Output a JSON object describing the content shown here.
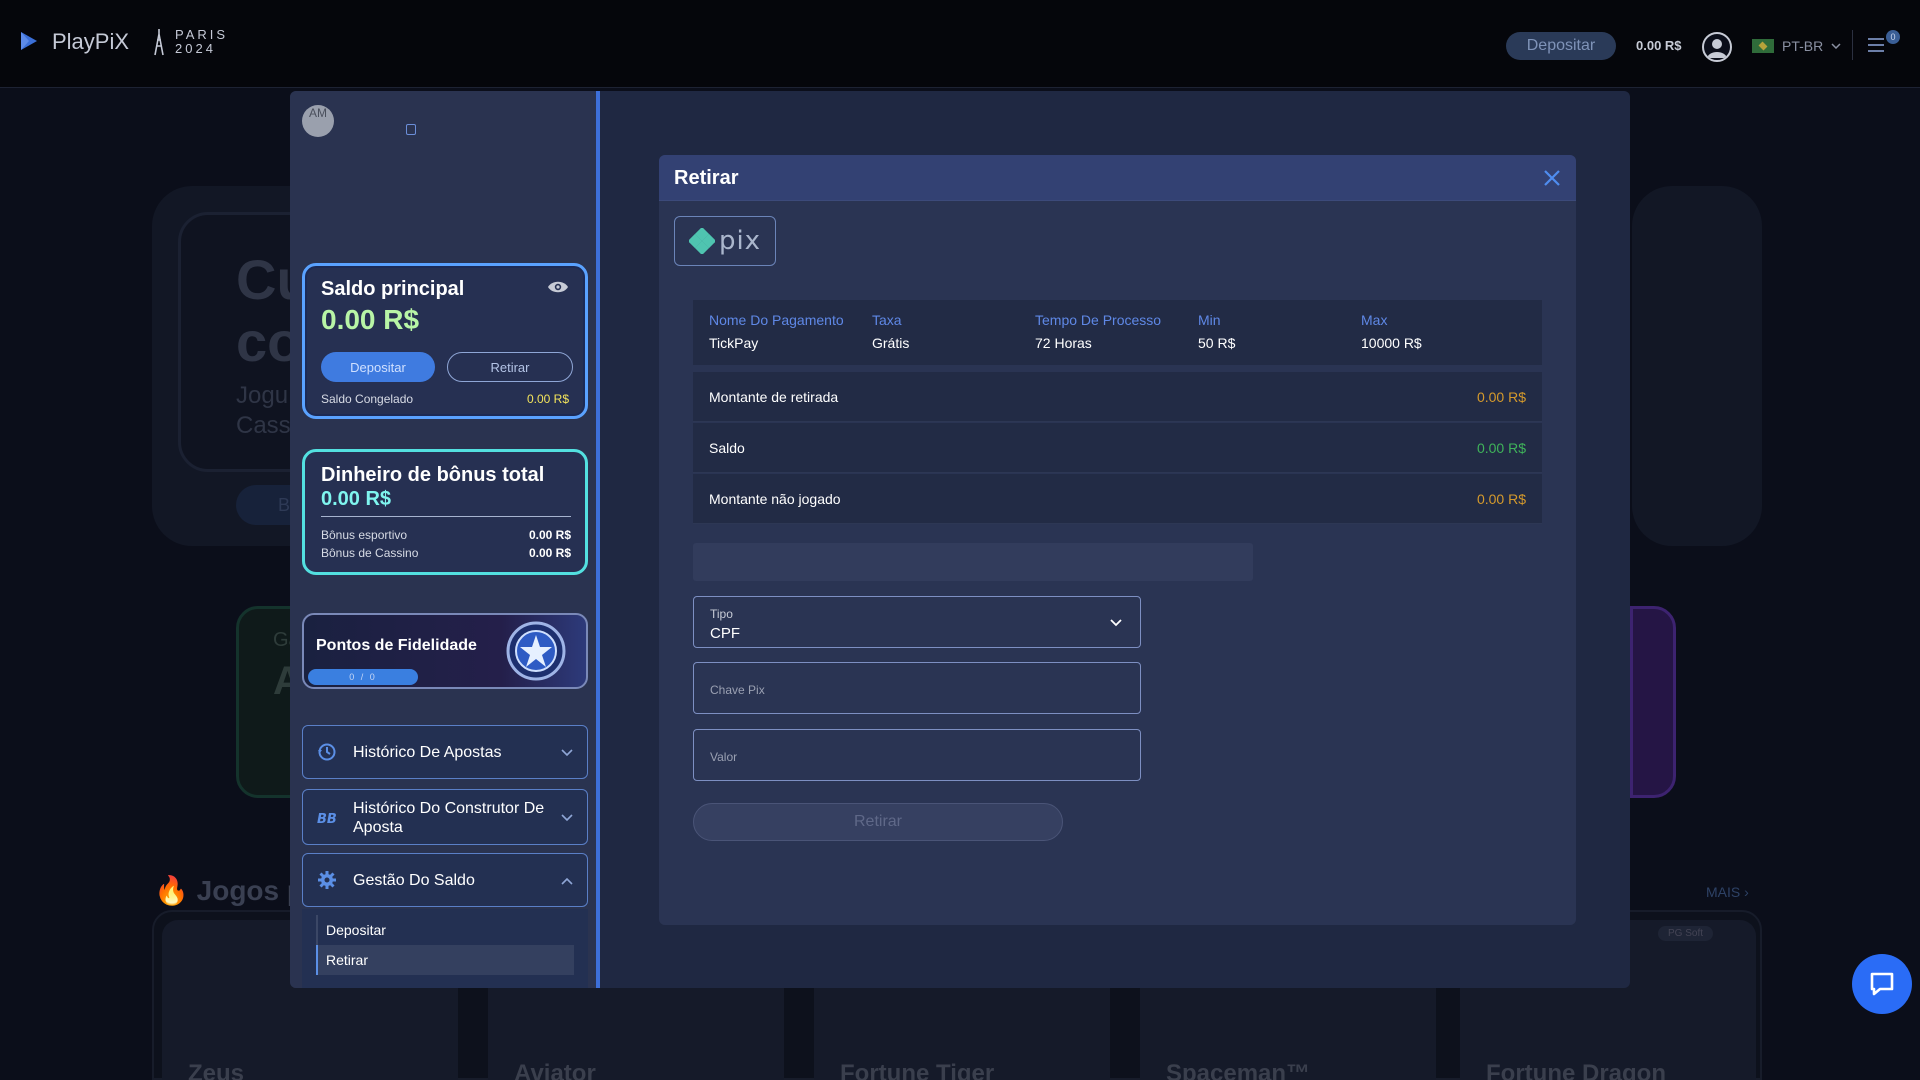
{
  "topbar": {
    "brand": "PlayPiX",
    "paris_line1": "PARIS",
    "paris_line2": "2024",
    "deposit_label": "Depositar",
    "balance": "0.00 R$",
    "language": "PT-BR",
    "notification_count": "0"
  },
  "background": {
    "hero_big": [
      "Cu",
      "co"
    ],
    "hero_small": [
      "Jogu",
      "Cass"
    ],
    "hero_btn": "B",
    "promo_letters": [
      "Ga",
      "A"
    ],
    "games_title": "Jogos p",
    "games_more": "MAIS",
    "provider_tag": "PG Soft",
    "games": [
      "Zeus",
      "Aviator",
      "Fortune Tiger",
      "Spaceman™",
      "Fortune Dragon"
    ]
  },
  "account": {
    "avatar_initials": "AM",
    "main_balance": {
      "title": "Saldo principal",
      "amount": "0.00 R$",
      "deposit_btn": "Depositar",
      "withdraw_btn": "Retirar",
      "frozen_label": "Saldo Congelado",
      "frozen_value": "0.00 R$"
    },
    "bonus": {
      "title": "Dinheiro de bônus total",
      "amount": "0.00 R$",
      "rows": [
        {
          "label": "Bônus esportivo",
          "value": "0.00 R$"
        },
        {
          "label": "Bônus de Cassino",
          "value": "0.00 R$"
        }
      ]
    },
    "loyalty": {
      "title": "Pontos de Fidelidade",
      "progress_text": "0 / 0"
    },
    "menu": [
      {
        "label": "Histórico De Apostas",
        "icon": "history-icon",
        "expanded": false
      },
      {
        "label": "Histórico Do Construtor De Aposta",
        "icon": "bet-builder-icon",
        "expanded": false
      },
      {
        "label": "Gestão Do Saldo",
        "icon": "gear-icon",
        "expanded": true
      }
    ],
    "submenu": [
      {
        "label": "Depositar",
        "active": false
      },
      {
        "label": "Retirar",
        "active": true
      }
    ]
  },
  "withdraw": {
    "title": "Retirar",
    "method": "pix",
    "info": {
      "headers": [
        "Nome Do Pagamento",
        "Taxa",
        "Tempo De Processo",
        "Min",
        "Max"
      ],
      "values": [
        "TickPay",
        "Grátis",
        "72 Horas",
        "50 R$",
        "10000 R$"
      ]
    },
    "amounts": [
      {
        "label": "Montante de retirada",
        "value": "0.00 R$",
        "color": "#d59a2c"
      },
      {
        "label": "Saldo",
        "value": "0.00 R$",
        "color": "#3fb35a"
      },
      {
        "label": "Montante não jogado",
        "value": "0.00 R$",
        "color": "#d59a2c"
      }
    ],
    "type_field": {
      "label": "Tipo",
      "value": "CPF"
    },
    "pix_key_placeholder": "Chave Pix",
    "value_placeholder": "Valor",
    "submit_label": "Retirar"
  },
  "colors": {
    "accent": "#3d6fd9",
    "main_card_border": "#5aa2ff",
    "bonus_card_border": "#53e0e0",
    "amount_green": "#b8f5a6",
    "bonus_cyan": "#7ff5ef"
  }
}
